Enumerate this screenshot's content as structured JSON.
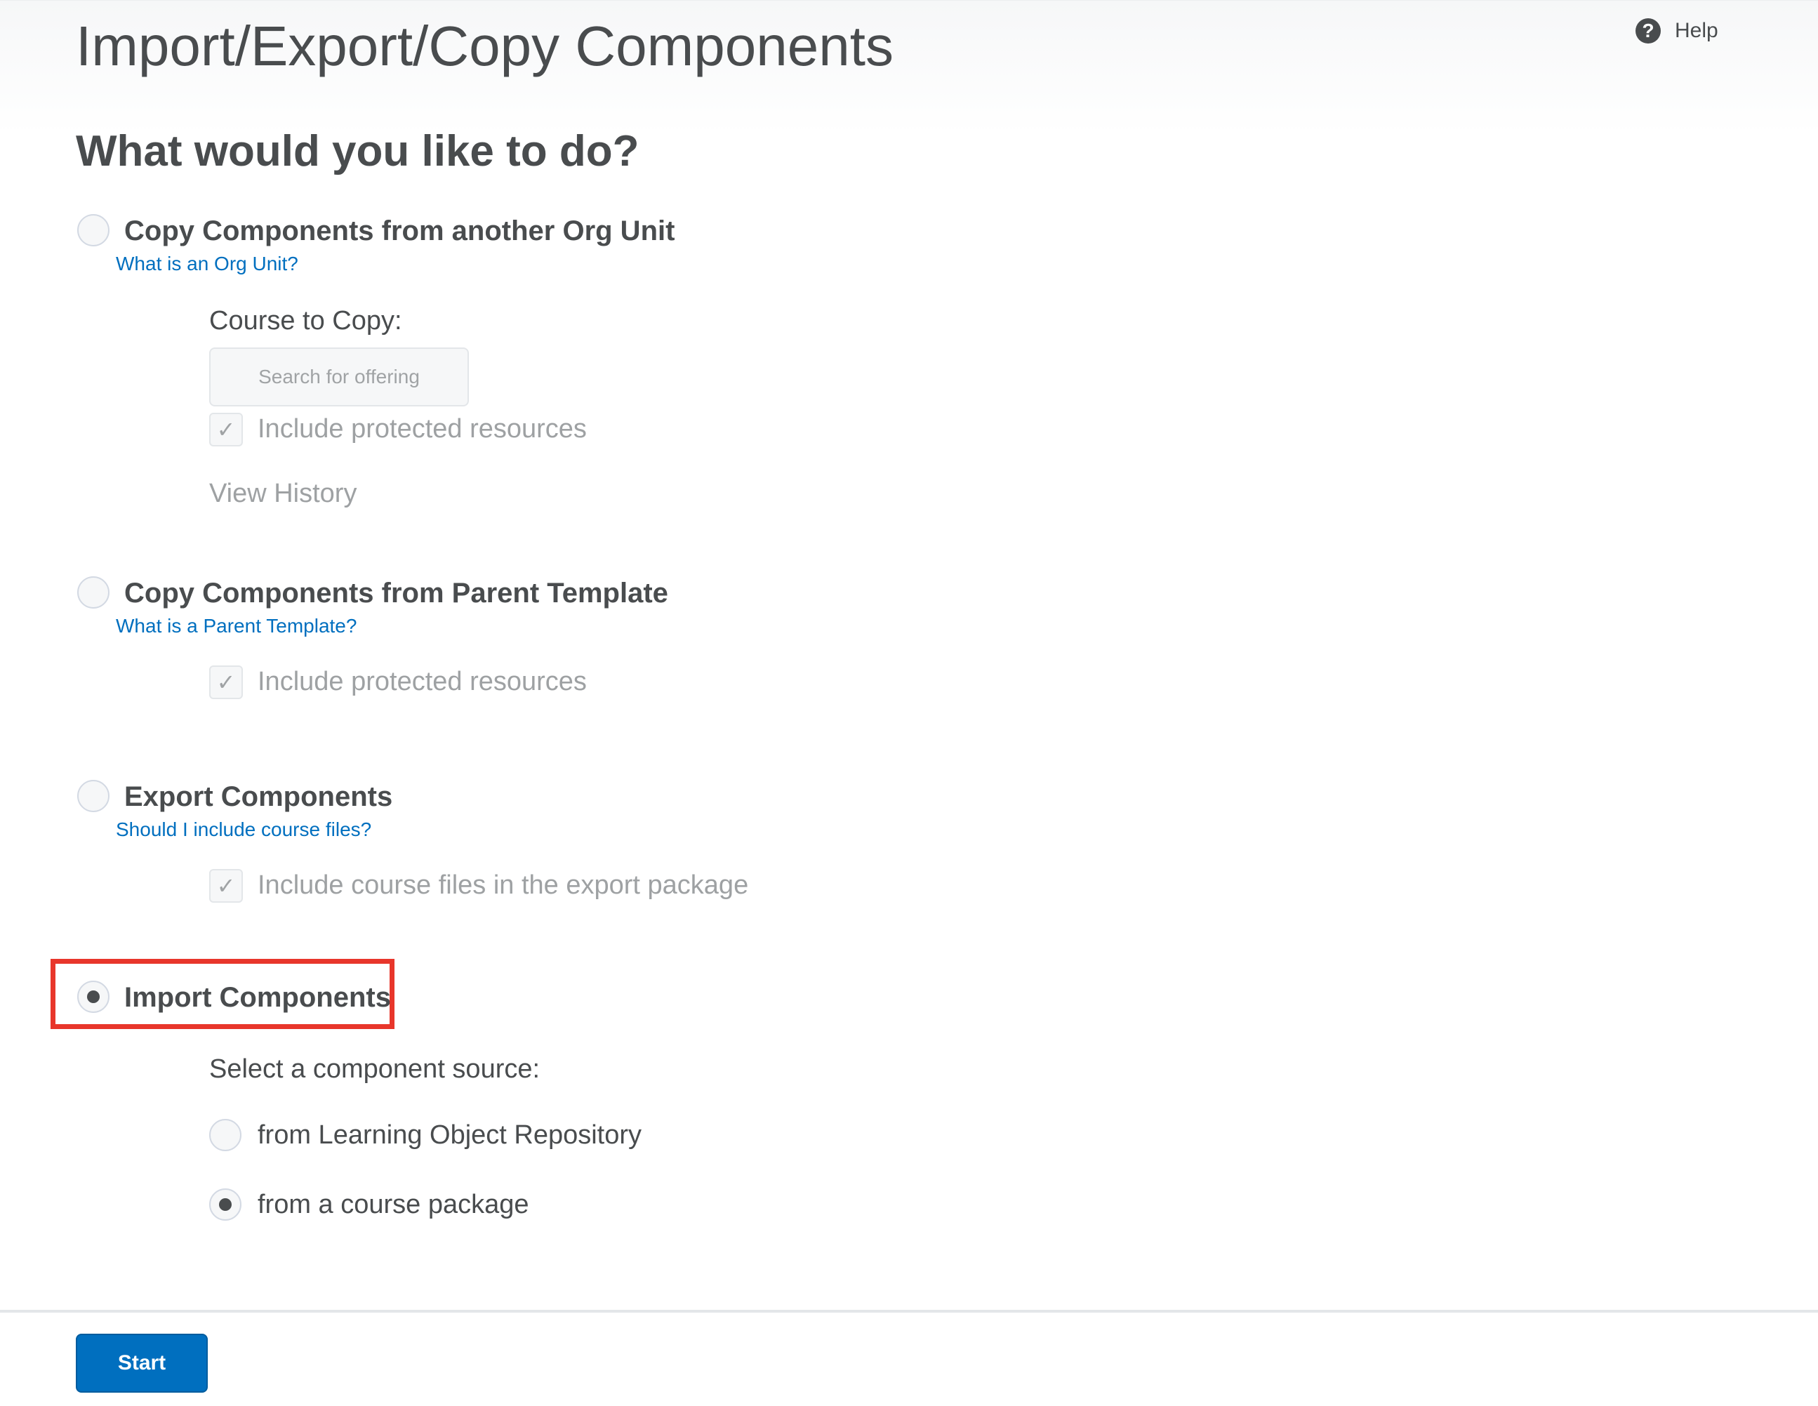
{
  "header": {
    "title": "Import/Export/Copy Components",
    "help_label": "Help"
  },
  "question": "What would you like to do?",
  "options": [
    {
      "label": "Copy Components from another Org Unit",
      "help": "What is an Org Unit?",
      "selected": false,
      "course_label": "Course to Copy:",
      "search_placeholder": "Search for offering",
      "checkbox_label": "Include protected resources",
      "checkbox_checked": true,
      "view_history": "View History"
    },
    {
      "label": "Copy Components from Parent Template",
      "help": "What is a Parent Template?",
      "selected": false,
      "checkbox_label": "Include protected resources",
      "checkbox_checked": true
    },
    {
      "label": "Export Components",
      "help": "Should I include course files?",
      "selected": false,
      "checkbox_label": "Include course files in the export package",
      "checkbox_checked": true
    },
    {
      "label": "Import Components",
      "selected": true,
      "source_label": "Select a component source:",
      "sources": [
        {
          "label": "from Learning Object Repository",
          "selected": false
        },
        {
          "label": "from a course package",
          "selected": true
        }
      ]
    }
  ],
  "footer": {
    "start_label": "Start"
  },
  "colors": {
    "link": "#006fbf",
    "primary_button": "#006fbf",
    "highlight": "#e8362b",
    "text": "#494c4e",
    "disabled_text": "#9ea1a3"
  }
}
